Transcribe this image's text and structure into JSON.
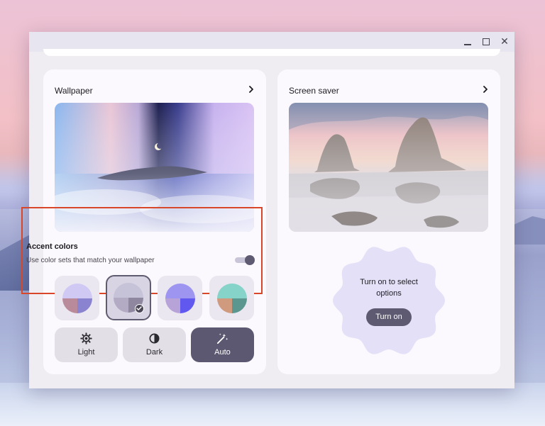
{
  "window": {
    "controls": {
      "minimize_icon": "minimize-icon",
      "maximize_icon": "maximize-icon",
      "close_icon": "close-icon",
      "close_glyph": "✕"
    }
  },
  "wallpaper": {
    "title": "Wallpaper",
    "chevron_icon": "chevron-right-icon"
  },
  "accent": {
    "title": "Accent colors",
    "description": "Use color sets that match your wallpaper",
    "toggle_on": true,
    "highlight_color": "#d9472b",
    "swatches": [
      {
        "top": "#cfc9f4",
        "left": "#b98a9a",
        "right": "#8a83cf",
        "selected": false
      },
      {
        "top": "#c6c2d8",
        "left": "#b2abc3",
        "right": "#8e879f",
        "selected": true
      },
      {
        "top": "#9d95f0",
        "left": "#b7a3d8",
        "right": "#6058ef",
        "selected": false
      },
      {
        "top": "#85d3c9",
        "left": "#cf9a7d",
        "right": "#5b978e",
        "selected": false
      }
    ]
  },
  "modes": [
    {
      "label": "Light",
      "icon": "brightness-icon",
      "active": false
    },
    {
      "label": "Dark",
      "icon": "contrast-icon",
      "active": false
    },
    {
      "label": "Auto",
      "icon": "magic-wand-icon",
      "active": true
    }
  ],
  "screensaver": {
    "title": "Screen saver",
    "chevron_icon": "chevron-right-icon",
    "prompt": "Turn on to select options",
    "button_label": "Turn on"
  },
  "colors": {
    "accent_dark": "#5e5a72",
    "card_bg": "#fbf9fd",
    "window_bg": "#efedf1",
    "blob": "#e4e0f8"
  }
}
